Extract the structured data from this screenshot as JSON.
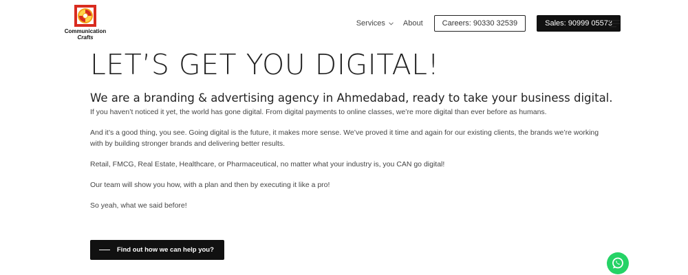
{
  "logo": {
    "line1": "Communication",
    "line2": "Crafts"
  },
  "nav": {
    "services": "Services",
    "about": "About",
    "careers": "Careers: 90330 32539",
    "sales": "Sales: 90999 05573"
  },
  "main": {
    "headline": "LET’S GET YOU DIGITAL!",
    "subhead": "We are a branding & advertising agency in Ahmedabad, ready to take your business digital.",
    "paragraphs": [
      "If you haven’t noticed it yet, the world has gone digital. From digital payments to online classes, we’re more digital than ever before as humans.",
      "And it’s a good thing, you see. Going digital is the future, it makes more sense. We’ve proved it time and again for our existing clients, the brands we’re working with by building stronger brands and delivering better results.",
      "Retail, FMCG, Real Estate, Healthcare, or Pharmaceutical, no matter what your industry is, you CAN go digital!",
      "Our team will show you how, with a plan and then by executing it like a pro!",
      "So yeah, what we said before!"
    ],
    "cta": "Find out how we can help you?"
  },
  "icons": {
    "menu": "hamburger-menu-icon",
    "services_dropdown": "chevron-down-icon",
    "whatsapp": "whatsapp-icon",
    "cta_decoration": "dash-line-icon"
  },
  "colors": {
    "logo_red": "#d92b1f",
    "logo_orange": "#f3a11b",
    "button_dark": "#111111",
    "whatsapp_green": "#25d366"
  }
}
